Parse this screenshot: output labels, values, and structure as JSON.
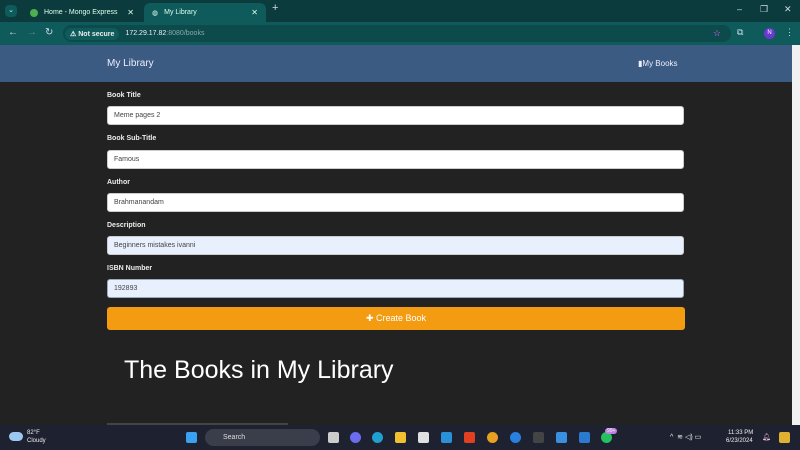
{
  "browser": {
    "tabs": [
      {
        "label": "Home - Mongo Express",
        "active": false
      },
      {
        "label": "My Library",
        "active": true
      }
    ],
    "security": "Not secure",
    "url_host": "172.29.17.82",
    "url_rest": ":8080/books",
    "profile": "N"
  },
  "header": {
    "brand": "My Library",
    "nav_link": "My Books"
  },
  "form": {
    "fields": [
      {
        "label": "Book Title",
        "value": "Meme pages 2"
      },
      {
        "label": "Book Sub-Title",
        "value": "Famous"
      },
      {
        "label": "Author",
        "value": "Brahmanandam"
      },
      {
        "label": "Description",
        "value": "Beginners mistakes ivanni"
      },
      {
        "label": "ISBN Number",
        "value": "192893"
      }
    ],
    "submit": "Create Book"
  },
  "list_heading": "The Books in My Library",
  "taskbar": {
    "temp": "82°F",
    "weather": "Cloudy",
    "search": "Search",
    "badge": "99+",
    "time": "11:33 PM",
    "date": "6/23/2024"
  },
  "colors": {
    "header": "#3b5b82",
    "button": "#f39c12",
    "background": "#222222"
  }
}
